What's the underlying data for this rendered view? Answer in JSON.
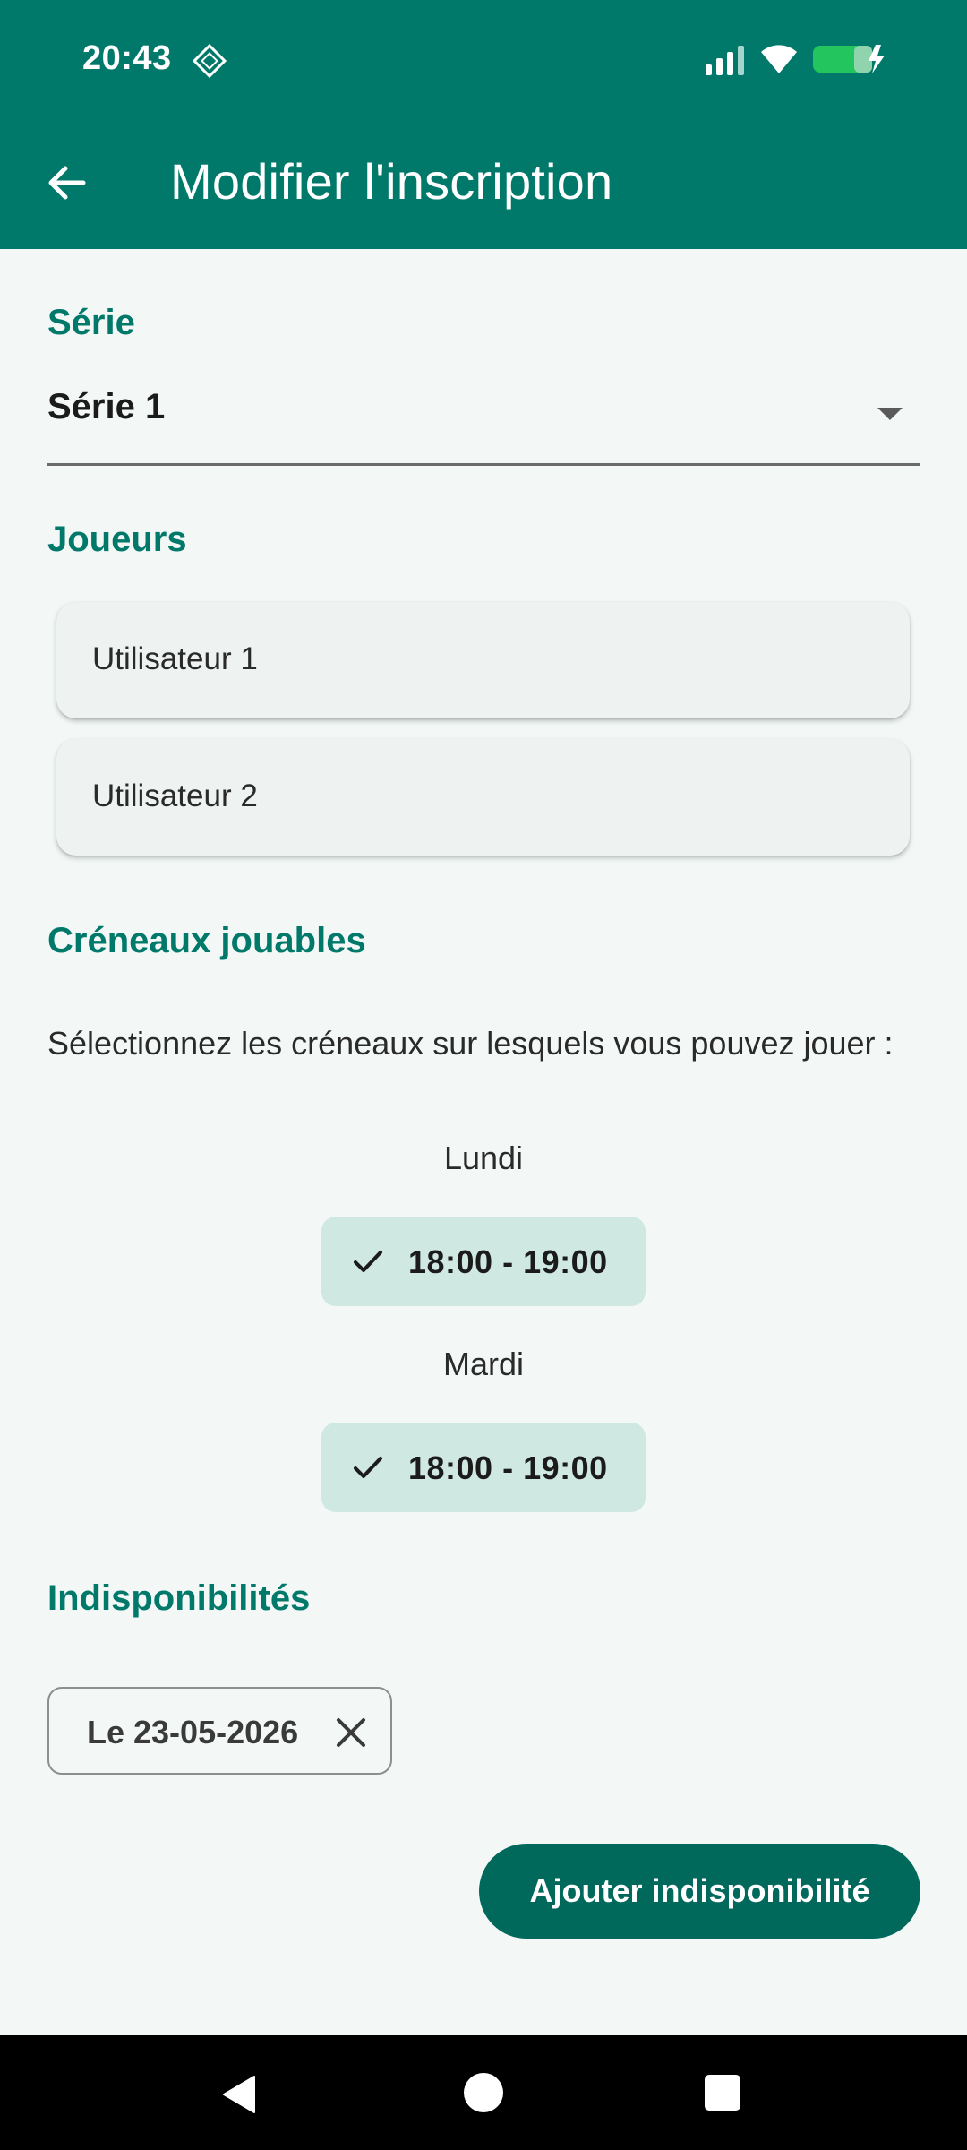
{
  "status_bar": {
    "time": "20:43",
    "icons": [
      "sim-icon",
      "signal-icon",
      "wifi-icon",
      "battery-charging-icon"
    ],
    "battery_color": "#22c55e"
  },
  "app_bar": {
    "title": "Modifier l'inscription",
    "back_icon": "arrow-back-icon",
    "color": "#00796b"
  },
  "serie": {
    "section_title": "Série",
    "selected_value": "Série 1"
  },
  "players": {
    "section_title": "Joueurs",
    "items": [
      {
        "name": "Utilisateur 1"
      },
      {
        "name": "Utilisateur 2"
      }
    ]
  },
  "slots": {
    "section_title": "Créneaux jouables",
    "instructions": "Sélectionnez les créneaux sur lesquels vous pouvez jouer :",
    "days": [
      {
        "day": "Lundi",
        "slot": "18:00 - 19:00",
        "selected": true
      },
      {
        "day": "Mardi",
        "slot": "18:00 - 19:00",
        "selected": true
      }
    ]
  },
  "unavailability": {
    "section_title": "Indisponibilités",
    "chips": [
      {
        "label": "Le 23-05-2026"
      }
    ],
    "add_button_label": "Ajouter indisponibilité"
  },
  "navigation": {
    "buttons": [
      "nav-back-icon",
      "nav-home-icon",
      "nav-recents-icon"
    ]
  },
  "colors": {
    "primary": "#00796b",
    "button": "#00695c",
    "chip_selected": "#cfe8e2",
    "background": "#f3f8f6"
  }
}
